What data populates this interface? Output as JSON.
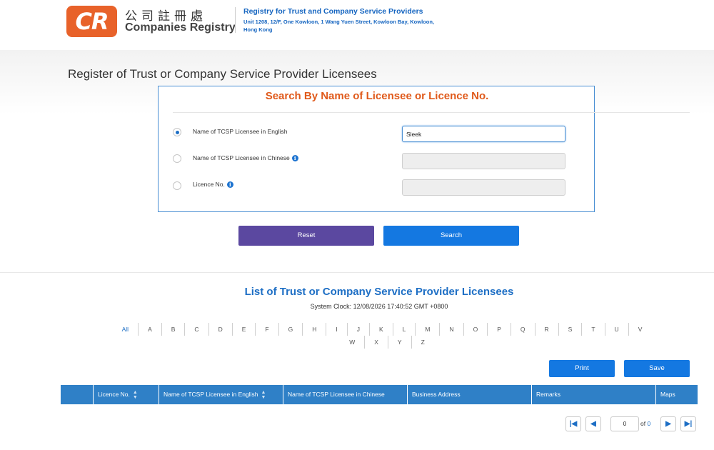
{
  "header": {
    "logo_mark": "CR",
    "logo_zh": "公司註冊處",
    "logo_en": "Companies Registry",
    "registry_title": "Registry for Trust and Company Service Providers",
    "registry_address": "Unit 1208, 12/F, One Kowloon, 1 Wang Yuen Street, Kowloon Bay, Kowloon, Hong Kong"
  },
  "page_title": "Register of Trust or Company Service Provider Licensees",
  "search": {
    "heading": "Search By Name of Licensee or Licence No.",
    "options": [
      {
        "label": "Name of TCSP Licensee in English",
        "selected": true,
        "info": false,
        "value": "Sleek"
      },
      {
        "label": "Name of TCSP Licensee in Chinese",
        "selected": false,
        "info": true,
        "value": ""
      },
      {
        "label": "Licence No.",
        "selected": false,
        "info": true,
        "value": ""
      }
    ],
    "reset_label": "Reset",
    "search_label": "Search"
  },
  "list": {
    "title": "List of Trust or Company Service Provider Licensees",
    "clock": "System Clock: 12/08/2026 17:40:52 GMT +0800",
    "alphabet_row1": [
      "All",
      "A",
      "B",
      "C",
      "D",
      "E",
      "F",
      "G",
      "H",
      "I",
      "J",
      "K",
      "L",
      "M",
      "N",
      "O",
      "P",
      "Q",
      "R",
      "S",
      "T",
      "U",
      "V"
    ],
    "alphabet_row2": [
      "W",
      "X",
      "Y",
      "Z"
    ],
    "print_label": "Print",
    "save_label": "Save",
    "columns": [
      {
        "label": "",
        "sortable": false
      },
      {
        "label": "Licence No.",
        "sortable": true
      },
      {
        "label": "Name of TCSP Licensee in English",
        "sortable": true
      },
      {
        "label": "Name of TCSP Licensee in Chinese",
        "sortable": false
      },
      {
        "label": "Business Address",
        "sortable": false
      },
      {
        "label": "Remarks",
        "sortable": false
      },
      {
        "label": "Maps",
        "sortable": false
      }
    ]
  },
  "pager": {
    "current_page": "0",
    "of_label": "of",
    "total_pages": "0"
  },
  "colors": {
    "brand_orange": "#e8622a",
    "link_blue": "#1e6fc5",
    "button_blue": "#1478e1",
    "reset_purple": "#5b48a0",
    "table_header": "#2f80c7"
  }
}
